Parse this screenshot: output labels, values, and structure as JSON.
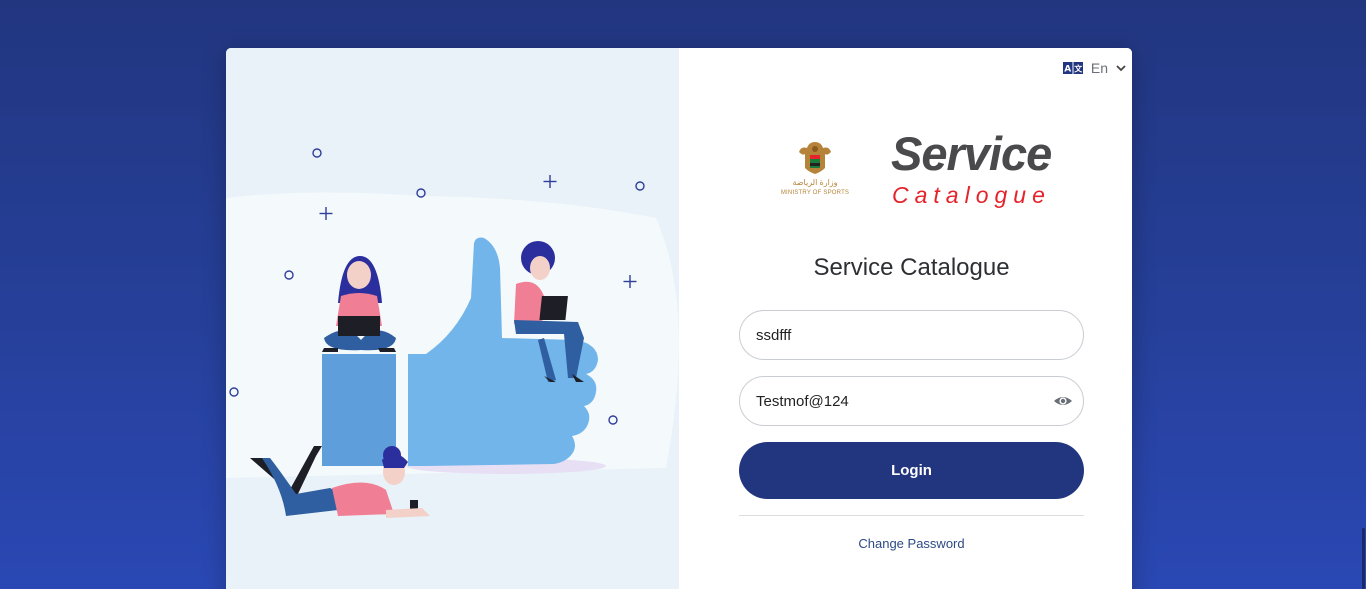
{
  "language": {
    "label": "En",
    "icon": "translate-icon"
  },
  "logos": {
    "ministry_ar": "وزارة الرياضة",
    "ministry_en": "MINISTRY OF SPORTS",
    "service_word": "Service",
    "catalogue_word": "Catalogue"
  },
  "form": {
    "title": "Service Catalogue",
    "username_value": "ssdfff",
    "password_value": "Testmof@124",
    "login_label": "Login",
    "change_password_label": "Change Password"
  },
  "colors": {
    "background": "#223680",
    "primary_button": "#223680",
    "logo_red": "#e4232b",
    "logo_gray": "#4a4a4c",
    "illustration_blue": "#72b5ea"
  }
}
